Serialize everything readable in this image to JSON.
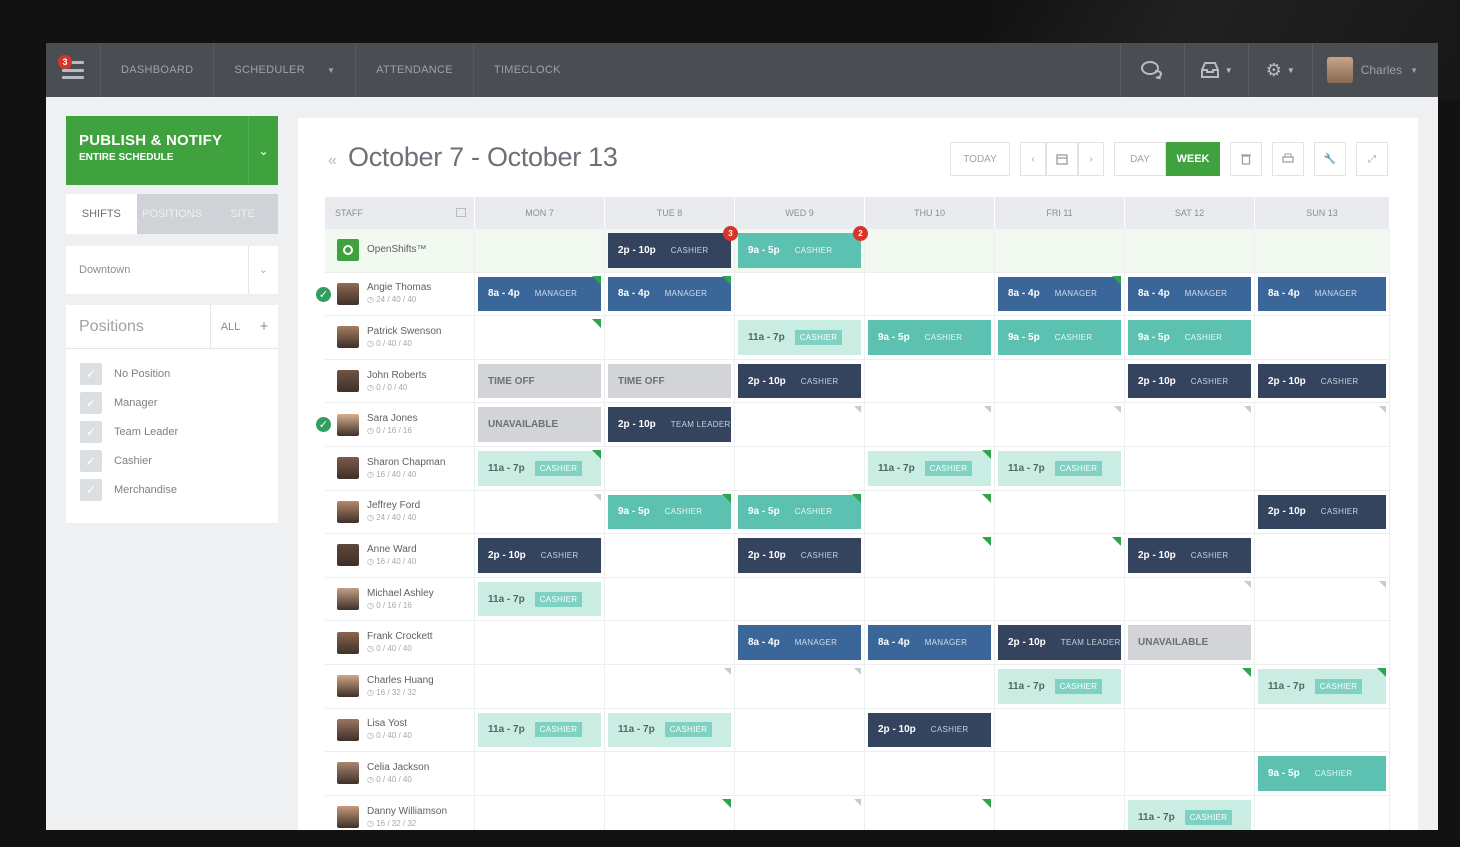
{
  "nav": {
    "badge": "3",
    "items": [
      "DASHBOARD",
      "SCHEDULER",
      "ATTENDANCE",
      "TIMECLOCK"
    ],
    "user": "Charles"
  },
  "sidebar": {
    "publish_line1": "PUBLISH & NOTIFY",
    "publish_line2": "ENTIRE SCHEDULE",
    "tabs": [
      "SHIFTS",
      "POSITIONS",
      "SITE"
    ],
    "location": "Downtown",
    "positions_title": "Positions",
    "positions_all": "ALL",
    "positions_add": "+",
    "positions": [
      "No Position",
      "Manager",
      "Team Leader",
      "Cashier",
      "Merchandise"
    ]
  },
  "header": {
    "title": "October 7 - October 13",
    "today": "TODAY",
    "day": "DAY",
    "week": "WEEK"
  },
  "grid": {
    "staff_header": "STAFF",
    "days": [
      "MON 7",
      "TUE 8",
      "WED 9",
      "THU 10",
      "FRI 11",
      "SAT 12",
      "SUN 13"
    ]
  },
  "colors": {
    "green": "#3fa23f",
    "navy": "#34435e",
    "blue": "#3a6699",
    "teal": "#5cc1b0",
    "mint": "#c9ede2",
    "gray": "#d2d4d7",
    "red": "#d9342b"
  },
  "rows": [
    {
      "name": "OpenShifts™",
      "sub": "",
      "open": true,
      "cells": [
        null,
        {
          "t": "2p - 10p",
          "r": "CASHIER",
          "c": "navy",
          "badge": "3"
        },
        {
          "t": "9a - 5p",
          "r": "CASHIER",
          "c": "teal",
          "badge": "2"
        },
        null,
        null,
        null,
        null
      ]
    },
    {
      "name": "Angie Thomas",
      "sub": "◷ 24 / 40 / 40",
      "check": true,
      "cells": [
        {
          "t": "8a - 4p",
          "r": "MANAGER",
          "c": "blue",
          "flag": "g"
        },
        {
          "t": "8a - 4p",
          "r": "MANAGER",
          "c": "blue",
          "flag": "g"
        },
        null,
        null,
        {
          "t": "8a - 4p",
          "r": "MANAGER",
          "c": "blue",
          "flag": "g"
        },
        {
          "t": "8a - 4p",
          "r": "MANAGER",
          "c": "blue"
        },
        {
          "t": "8a - 4p",
          "r": "MANAGER",
          "c": "blue"
        }
      ]
    },
    {
      "name": "Patrick Swenson",
      "sub": "◷ 0 / 40 / 40",
      "cells": [
        {
          "flag": "g"
        },
        null,
        {
          "t": "11a - 7p",
          "r": "CASHIER",
          "c": "mint"
        },
        {
          "t": "9a - 5p",
          "r": "CASHIER",
          "c": "teal"
        },
        {
          "t": "9a - 5p",
          "r": "CASHIER",
          "c": "teal"
        },
        {
          "t": "9a - 5p",
          "r": "CASHIER",
          "c": "teal"
        },
        null
      ]
    },
    {
      "name": "John Roberts",
      "sub": "◷ 0 / 0 / 40",
      "cells": [
        {
          "t": "TIME OFF",
          "c": "gray"
        },
        {
          "t": "TIME OFF",
          "c": "gray"
        },
        {
          "t": "2p - 10p",
          "r": "CASHIER",
          "c": "navy"
        },
        null,
        null,
        {
          "t": "2p - 10p",
          "r": "CASHIER",
          "c": "navy"
        },
        {
          "t": "2p - 10p",
          "r": "CASHIER",
          "c": "navy"
        }
      ]
    },
    {
      "name": "Sara Jones",
      "sub": "◷ 0 / 16 / 16",
      "check": true,
      "cells": [
        {
          "t": "UNAVAILABLE",
          "c": "gray"
        },
        {
          "t": "2p - 10p",
          "r": "TEAM LEADER",
          "c": "navy"
        },
        {
          "flag": "x"
        },
        {
          "flag": "x"
        },
        {
          "flag": "x"
        },
        {
          "flag": "x"
        },
        {
          "flag": "x"
        }
      ]
    },
    {
      "name": "Sharon Chapman",
      "sub": "◷ 16 / 40 / 40",
      "cells": [
        {
          "t": "11a - 7p",
          "r": "CASHIER",
          "c": "mint",
          "flag": "g"
        },
        null,
        null,
        {
          "t": "11a - 7p",
          "r": "CASHIER",
          "c": "mint",
          "flag": "g"
        },
        {
          "t": "11a - 7p",
          "r": "CASHIER",
          "c": "mint"
        },
        null,
        null
      ]
    },
    {
      "name": "Jeffrey Ford",
      "sub": "◷ 24 / 40 / 40",
      "cells": [
        {
          "flag": "x"
        },
        {
          "t": "9a - 5p",
          "r": "CASHIER",
          "c": "teal",
          "flag": "g"
        },
        {
          "t": "9a - 5p",
          "r": "CASHIER",
          "c": "teal",
          "flag": "g"
        },
        {
          "flag": "g"
        },
        null,
        null,
        {
          "t": "2p - 10p",
          "r": "CASHIER",
          "c": "navy"
        }
      ]
    },
    {
      "name": "Anne Ward",
      "sub": "◷ 16 / 40 / 40",
      "cells": [
        {
          "t": "2p - 10p",
          "r": "CASHIER",
          "c": "navy"
        },
        null,
        {
          "t": "2p - 10p",
          "r": "CASHIER",
          "c": "navy"
        },
        {
          "flag": "g"
        },
        {
          "flag": "g"
        },
        {
          "t": "2p - 10p",
          "r": "CASHIER",
          "c": "navy"
        },
        null
      ]
    },
    {
      "name": "Michael Ashley",
      "sub": "◷ 0 / 16 / 16",
      "cells": [
        {
          "t": "11a - 7p",
          "r": "CASHIER",
          "c": "mint"
        },
        null,
        null,
        null,
        null,
        {
          "flag": "x"
        },
        {
          "flag": "x"
        }
      ]
    },
    {
      "name": "Frank Crockett",
      "sub": "◷ 0 / 40 / 40",
      "cells": [
        null,
        null,
        {
          "t": "8a - 4p",
          "r": "MANAGER",
          "c": "blue"
        },
        {
          "t": "8a - 4p",
          "r": "MANAGER",
          "c": "blue"
        },
        {
          "t": "2p - 10p",
          "r": "TEAM LEADER",
          "c": "navy"
        },
        {
          "t": "UNAVAILABLE",
          "c": "gray"
        },
        null
      ]
    },
    {
      "name": "Charles Huang",
      "sub": "◷ 16 / 32 / 32",
      "cells": [
        null,
        {
          "flag": "x"
        },
        {
          "flag": "x"
        },
        null,
        {
          "t": "11a - 7p",
          "r": "CASHIER",
          "c": "mint"
        },
        {
          "flag": "g"
        },
        {
          "t": "11a - 7p",
          "r": "CASHIER",
          "c": "mint",
          "flag": "g"
        }
      ]
    },
    {
      "name": "Lisa Yost",
      "sub": "◷ 0 / 40 / 40",
      "cells": [
        {
          "t": "11a - 7p",
          "r": "CASHIER",
          "c": "mint"
        },
        {
          "t": "11a - 7p",
          "r": "CASHIER",
          "c": "mint"
        },
        null,
        {
          "t": "2p - 10p",
          "r": "CASHIER",
          "c": "navy"
        },
        null,
        null,
        null
      ]
    },
    {
      "name": "Celia Jackson",
      "sub": "◷ 0 / 40 / 40",
      "cells": [
        null,
        null,
        null,
        null,
        null,
        null,
        {
          "t": "9a - 5p",
          "r": "CASHIER",
          "c": "teal"
        }
      ]
    },
    {
      "name": "Danny Williamson",
      "sub": "◷ 16 / 32 / 32",
      "cells": [
        null,
        {
          "flag": "g"
        },
        {
          "flag": "x"
        },
        {
          "flag": "g"
        },
        null,
        {
          "t": "11a - 7p",
          "r": "CASHIER",
          "c": "mint"
        },
        null
      ]
    }
  ]
}
